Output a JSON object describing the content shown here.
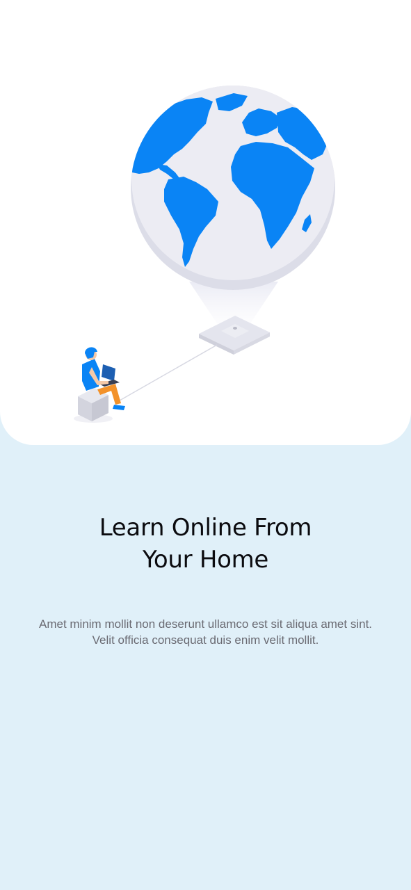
{
  "onboarding": {
    "illustration": {
      "icon": "globe-learning-illustration",
      "accent_color": "#0a84f5",
      "secondary_color": "#f3922a",
      "globe_base_color": "#e9e9f2"
    },
    "title_line1": "Learn Online From",
    "title_line2": "Your Home",
    "description": "Amet minim mollit non deserunt ullamco est sit aliqua amet sint. Velit officia consequat duis enim velit mollit."
  },
  "colors": {
    "background": "#e0f0f9",
    "card": "#ffffff",
    "title": "#0b0b0f",
    "body_text": "#6a6a72"
  }
}
